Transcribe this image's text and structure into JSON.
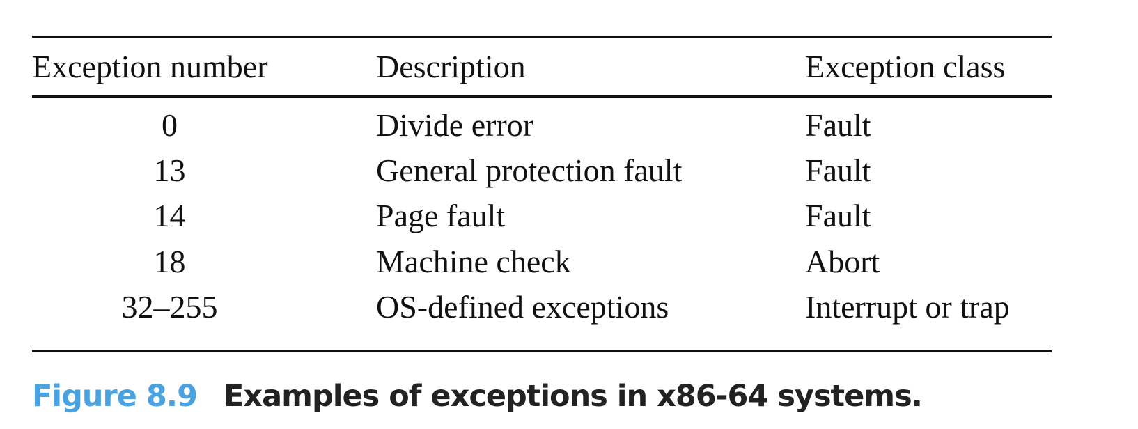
{
  "table": {
    "headers": [
      "Exception number",
      "Description",
      "Exception class"
    ],
    "rows": [
      {
        "number": "0",
        "description": "Divide error",
        "class": "Fault"
      },
      {
        "number": "13",
        "description": "General protection fault",
        "class": "Fault"
      },
      {
        "number": "14",
        "description": "Page fault",
        "class": "Fault"
      },
      {
        "number": "18",
        "description": "Machine check",
        "class": "Abort"
      },
      {
        "number": "32–255",
        "description": "OS-defined exceptions",
        "class": "Interrupt or trap"
      }
    ]
  },
  "caption": {
    "label": "Figure 8.9",
    "title": "Examples of exceptions in x86-64 systems.",
    "label_color": "#4aa3e0"
  }
}
